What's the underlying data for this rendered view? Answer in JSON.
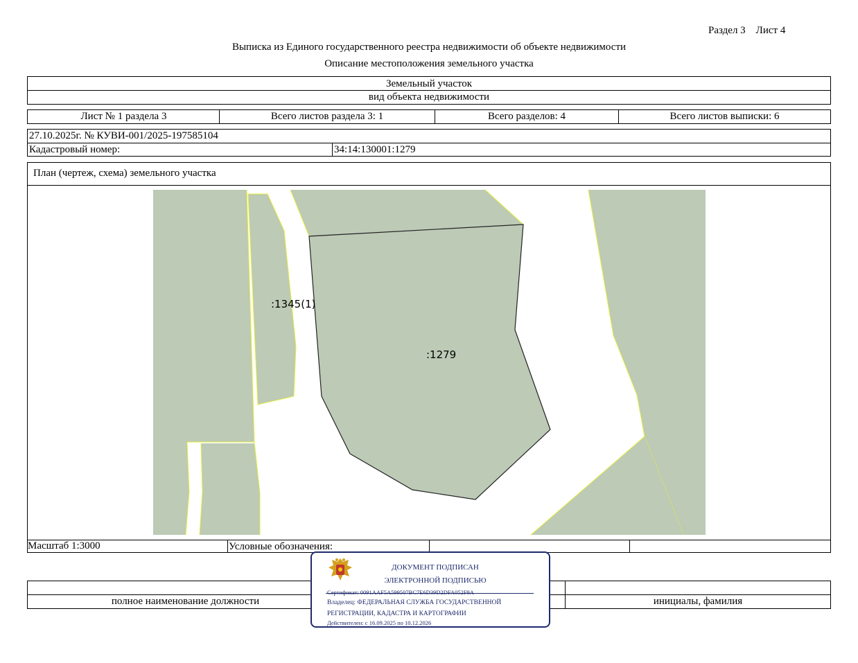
{
  "header": {
    "section_sheet": "Раздел 3    Лист 4",
    "title": "Выписка из Единого государственного реестра недвижимости об объекте недвижимости",
    "subtitle": "Описание местоположения земельного участка"
  },
  "object": {
    "type": "Земельный участок",
    "type_caption": "вид объекта недвижимости"
  },
  "sheet_info": {
    "sheet": "Лист № 1 раздела 3",
    "total_section_sheets": "Всего листов раздела 3: 1",
    "total_sections": "Всего разделов: 4",
    "total_sheets": "Всего листов выписки: 6"
  },
  "record": {
    "date_number": "27.10.2025г. № КУВИ-001/2025-197585104",
    "cadastral_label": "Кадастровый номер:",
    "cadastral_value": "34:14:130001:1279"
  },
  "plan": {
    "title": "План (чертеж, схема) земельного участка",
    "label_main": ":1279",
    "label_neighbor": ":1345(1)",
    "colors": {
      "parcel_fill": "#bccab6",
      "parcel_border_main": "#222222",
      "parcel_border_neighbor": "#e6ee3a"
    }
  },
  "footer": {
    "scale": "Масштаб 1:3000",
    "legend": "Условные обозначения:",
    "position_caption": "полное наименование должности",
    "name_caption": "инициалы, фамилия"
  },
  "stamp": {
    "line1": "ДОКУМЕНТ ПОДПИСАН",
    "line2": "ЭЛЕКТРОННОЙ ПОДПИСЬЮ",
    "certificate": "Сертификат: 0091AAF5A599507BC7E6D39D2DFA052F9A",
    "owner_1": "Владелец: ФЕДЕРАЛЬНАЯ СЛУЖБА ГОСУДАРСТВЕННОЙ",
    "owner_2": "РЕГИСТРАЦИИ, КАДАСТРА И КАРТОГРАФИИ",
    "validity": "Действителен: с 16.09.2025 по 10.12.2026",
    "color": "#1e2a6b"
  }
}
